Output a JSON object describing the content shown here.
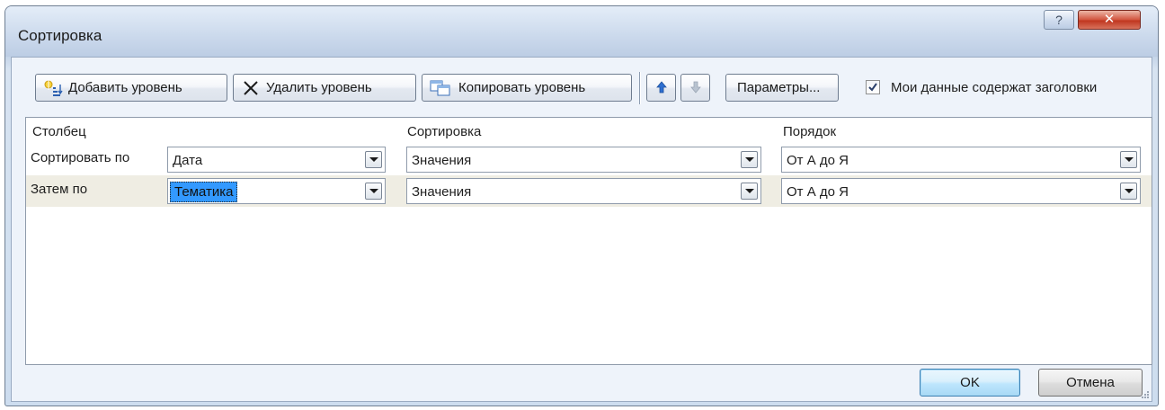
{
  "window": {
    "title": "Сортировка"
  },
  "toolbar": {
    "add_level": "Добавить уровень",
    "delete_level": "Удалить уровень",
    "copy_level": "Копировать уровень",
    "options": "Параметры...",
    "headers_checkbox": {
      "label": "Мои данные содержат заголовки",
      "checked": true
    }
  },
  "grid": {
    "headers": {
      "column": "Столбец",
      "sort_on": "Сортировка",
      "order": "Порядок"
    },
    "rows": [
      {
        "label": "Сортировать по",
        "column": "Дата",
        "sort_on": "Значения",
        "order": "От А до Я"
      },
      {
        "label": "Затем по",
        "column": "Тематика",
        "sort_on": "Значения",
        "order": "От А до Я",
        "selected": true
      }
    ]
  },
  "buttons": {
    "ok": "OK",
    "cancel": "Отмена"
  },
  "icons": {
    "help": "help-icon",
    "close": "close-icon",
    "up": "arrow-up-icon",
    "down": "arrow-down-icon"
  },
  "colors": {
    "selection": "#3399ff",
    "active_row": "#efede3",
    "close_button": "#c0361f"
  }
}
